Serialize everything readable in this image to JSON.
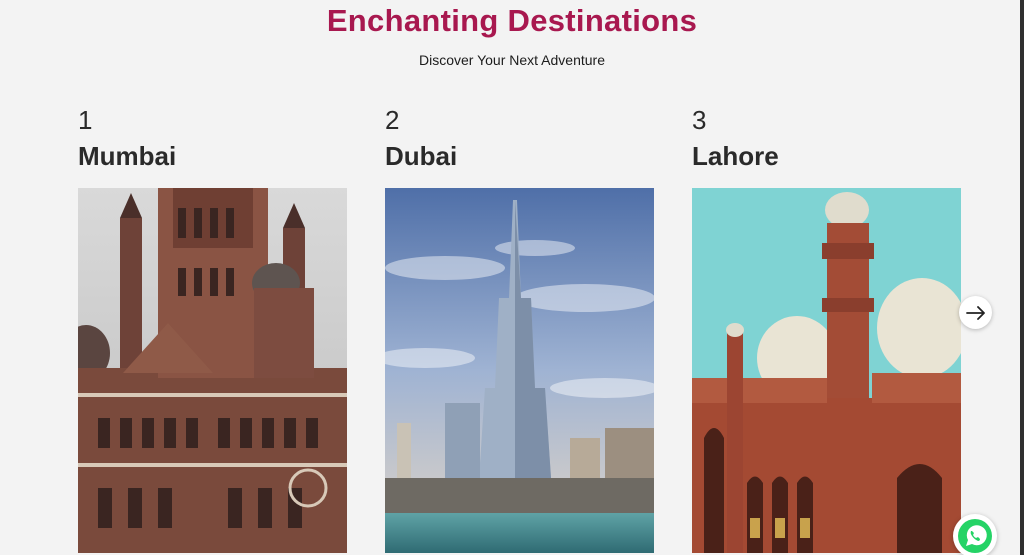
{
  "header": {
    "title": "Enchanting Destinations",
    "subtitle": "Discover Your Next Adventure"
  },
  "destinations": [
    {
      "number": "1",
      "name": "Mumbai"
    },
    {
      "number": "2",
      "name": "Dubai"
    },
    {
      "number": "3",
      "name": "Lahore"
    }
  ],
  "icons": {
    "next": "arrow-right-icon",
    "chat": "whatsapp-icon"
  },
  "colors": {
    "accent": "#a8184f",
    "background": "#f3f3f3",
    "whatsapp": "#25d366"
  }
}
